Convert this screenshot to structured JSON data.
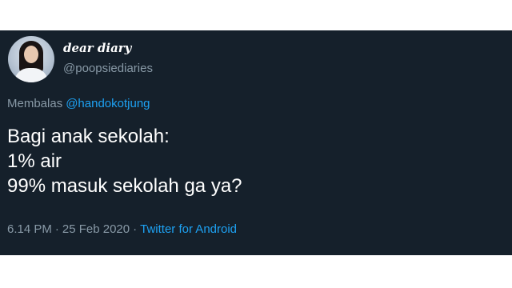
{
  "user": {
    "display_name": "dear diary",
    "handle": "@poopsiediaries"
  },
  "reply": {
    "prefix": "Membalas",
    "mention": "@handokotjung"
  },
  "tweet": {
    "lines": [
      "Bagi anak sekolah:",
      "1% air",
      "99% masuk sekolah ga ya?"
    ]
  },
  "meta": {
    "time": "6.14 PM",
    "separator": "·",
    "date": "25 Feb 2020",
    "source": "Twitter for Android"
  },
  "colors": {
    "background": "#15202b",
    "text": "#ffffff",
    "secondary": "#8899a6",
    "link": "#1da1f2"
  }
}
